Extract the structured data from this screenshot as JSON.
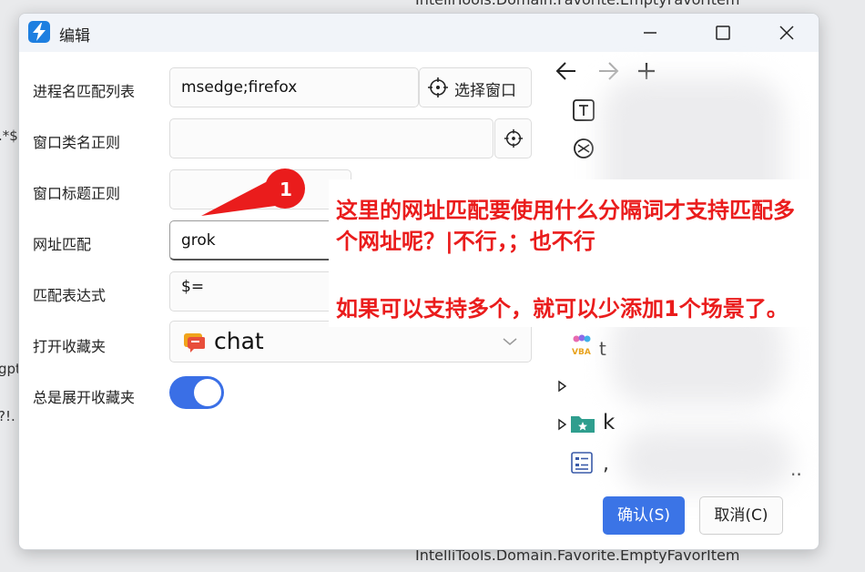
{
  "background": {
    "top_text": "IntelliTools.Domain.Favorite.EmptyFavorItem",
    "bottom_text": "IntelliTools.Domain.Favorite.EmptyFavorItem",
    "left_fragments": [
      ".*$",
      "gpt",
      "?!."
    ]
  },
  "window": {
    "title": "编辑"
  },
  "form": {
    "process_label": "进程名匹配列表",
    "process_value": "msedge;firefox",
    "select_window_label": "选择窗口",
    "class_label": "窗口类名正则",
    "class_value": "",
    "title_label": "窗口标题正则",
    "title_value": "",
    "url_label": "网址匹配",
    "url_value": "grok",
    "expr_label": "匹配表达式",
    "expr_value": "$=",
    "open_fav_label": "打开收藏夹",
    "open_fav_value": "chat",
    "expand_label": "总是展开收藏夹",
    "expand_on": true
  },
  "tree": {
    "items": [
      {
        "icon": "text-icon",
        "label": ""
      },
      {
        "icon": "network-icon",
        "label": ""
      },
      {
        "icon": "vba-icon",
        "label": "t"
      },
      {
        "icon": "expand-arrow-icon",
        "label": ""
      },
      {
        "icon": "folder-star-icon",
        "label": "k"
      },
      {
        "icon": "list-icon",
        "label": ","
      }
    ],
    "vba_text": "VBA",
    "trailing_dots": ".."
  },
  "annotation": {
    "badge_number": "1",
    "line1": "这里的网址匹配要使用什么分隔词才支持匹配多",
    "line2": "个网址呢？|不行，；也不行",
    "line3": "如果可以支持多个，就可以少添加1个场景了。",
    "color": "#ea1c1c"
  },
  "buttons": {
    "ok": "确认(S)",
    "cancel": "取消(C)"
  },
  "colors": {
    "accent": "#3b74e6",
    "toggle": "#3a6fe6"
  }
}
